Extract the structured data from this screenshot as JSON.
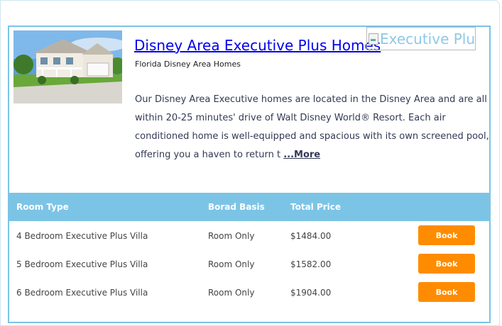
{
  "property": {
    "title": "Disney Area Executive Plus Homes",
    "subtitle": "Florida Disney Area Homes",
    "brand_image_alt": "Executive Plus",
    "description": "Our Disney Area Executive homes are located in the Disney Area and are all within 20-25 minutes' drive of Walt Disney World® Resort. Each air conditioned home is well-equipped and spacious with its own screened pool, offering you a haven to return t",
    "more_label": "...More"
  },
  "table": {
    "headers": {
      "room_type": "Room Type",
      "board_basis": "Borad Basis",
      "total_price": "Total Price"
    },
    "rows": [
      {
        "room_type": "4 Bedroom Executive Plus Villa",
        "board_basis": "Room Only",
        "price": "$1484.00",
        "action": "Book"
      },
      {
        "room_type": "5 Bedroom Executive Plus Villa",
        "board_basis": "Room Only",
        "price": "$1582.00",
        "action": "Book"
      },
      {
        "room_type": "6 Bedroom Executive Plus Villa",
        "board_basis": "Room Only",
        "price": "$1904.00",
        "action": "Book"
      }
    ]
  },
  "colors": {
    "accent_blue": "#7cc4e6",
    "book_orange": "#ff8c00",
    "link_blue": "#0000ee"
  },
  "icons": {
    "broken_image": "broken-image-icon"
  }
}
